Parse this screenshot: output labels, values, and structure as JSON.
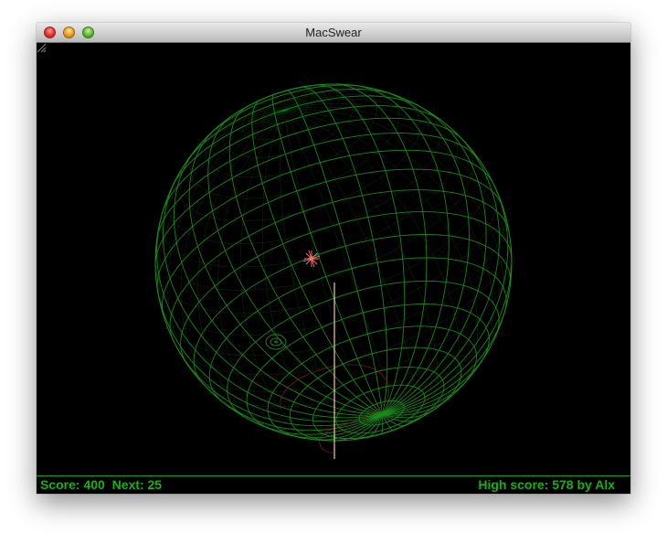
{
  "window": {
    "title": "MacSwear"
  },
  "status": {
    "score_label": "Score:",
    "score": "400",
    "next_label": "Next:",
    "next": "25",
    "high_score_label": "High score:",
    "high_score": "578",
    "high_score_by": "by",
    "high_score_holder": "Alx"
  },
  "colors": {
    "grid": "#1a8c1a",
    "status_text": "#18b018",
    "player": "#ff6a6a",
    "beam": "#f3c9a0",
    "background": "#000000"
  },
  "icons": {
    "close": "close-icon",
    "minimize": "minimize-icon",
    "zoom": "zoom-icon",
    "player": "player-ship-icon",
    "resize": "resize-grip-icon"
  }
}
